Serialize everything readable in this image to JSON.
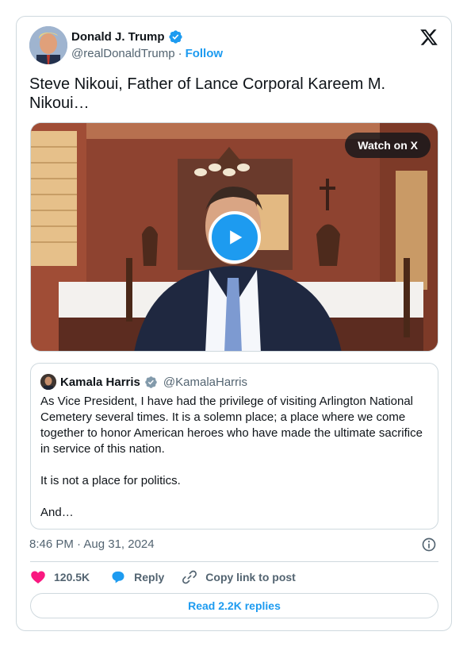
{
  "author": {
    "name": "Donald J. Trump",
    "handle": "@realDonaldTrump",
    "separator": "·",
    "follow_label": "Follow"
  },
  "tweet": {
    "text": "Steve Nikoui, Father of Lance Corporal Kareem M. Nikoui…"
  },
  "media": {
    "watch_label": "Watch on X"
  },
  "quoted_tweet": {
    "name": "Kamala Harris",
    "handle": "@KamalaHarris",
    "paragraphs": [
      "As Vice President, I have had the privilege of visiting Arlington National Cemetery several times. It is a solemn place; a place where we come together to honor American heroes who have made the ultimate sacrifice in service of this nation.",
      "It is not a place for politics.",
      "And…"
    ]
  },
  "timestamp": "8:46 PM · Aug 31, 2024",
  "actions": {
    "likes": "120.5K",
    "reply_label": "Reply",
    "copy_label": "Copy link to post"
  },
  "read_replies_label": "Read 2.2K replies",
  "colors": {
    "accent": "#1d9bf0",
    "like": "#f91880",
    "text_secondary": "#536471",
    "border": "#cfd9de"
  },
  "icons": {
    "verified": "verified-badge-icon",
    "logo": "x-logo-icon",
    "play": "play-icon",
    "info": "info-icon",
    "like": "heart-icon",
    "reply": "reply-bubble-icon",
    "copy": "link-icon"
  }
}
